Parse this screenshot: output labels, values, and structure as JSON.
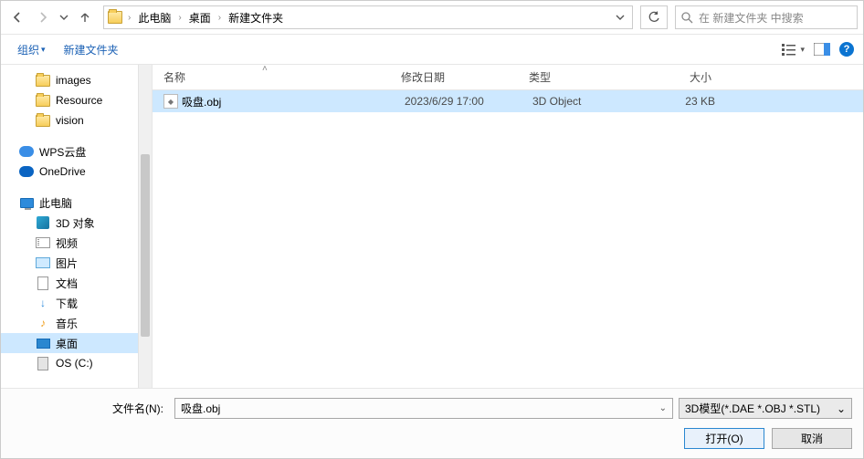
{
  "breadcrumb": {
    "p1": "此电脑",
    "p2": "桌面",
    "p3": "新建文件夹"
  },
  "search": {
    "placeholder": "在 新建文件夹 中搜索"
  },
  "toolbar": {
    "organize": "组织",
    "newfolder": "新建文件夹"
  },
  "tree": {
    "images": "images",
    "resource": "Resource",
    "vision": "vision",
    "wps": "WPS云盘",
    "onedrive": "OneDrive",
    "thispc": "此电脑",
    "obj3d": "3D 对象",
    "video": "视频",
    "pictures": "图片",
    "documents": "文档",
    "downloads": "下载",
    "music": "音乐",
    "desktop": "桌面",
    "osc": "OS (C:)"
  },
  "columns": {
    "name": "名称",
    "date": "修改日期",
    "type": "类型",
    "size": "大小"
  },
  "rows": [
    {
      "name": "吸盘.obj",
      "date": "2023/6/29 17:00",
      "type": "3D Object",
      "size": "23 KB"
    }
  ],
  "footer": {
    "filename_label": "文件名(N):",
    "filename_value": "吸盘.obj",
    "filter": "3D模型(*.DAE *.OBJ *.STL)",
    "open": "打开(O)",
    "cancel": "取消"
  }
}
